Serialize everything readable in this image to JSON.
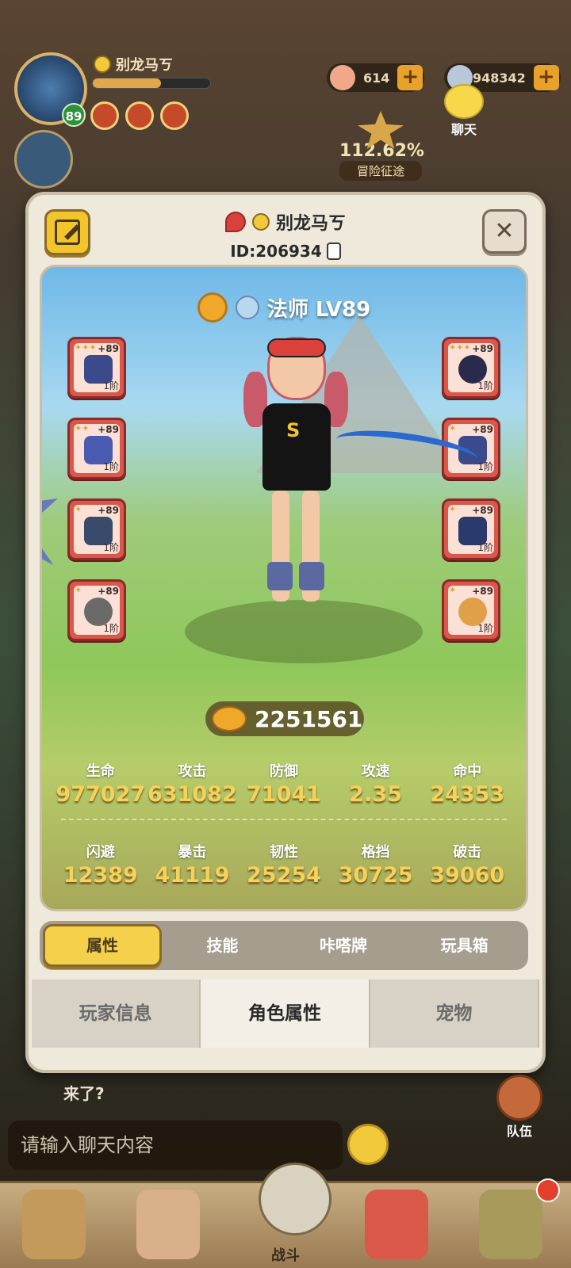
{
  "hud": {
    "player_name": "别龙马ㄎ",
    "level": "89",
    "currency_gems": "614",
    "currency_coins": "948342",
    "chat_label": "聊天",
    "adventure_percent": "112.62%",
    "adventure_label": "冒险征途"
  },
  "profile": {
    "name": "别龙马ㄎ",
    "id": "ID:206934",
    "class_title": "法师 LV89",
    "combat_power": "2251561"
  },
  "equipment_left": [
    {
      "level": "+89",
      "tier": "1阶",
      "stars": "✦✦✦"
    },
    {
      "level": "+89",
      "tier": "1阶",
      "stars": "✦✦"
    },
    {
      "level": "+89",
      "tier": "1阶",
      "stars": "✦"
    },
    {
      "level": "+89",
      "tier": "1阶",
      "stars": "✦"
    }
  ],
  "equipment_right": [
    {
      "level": "+89",
      "tier": "1阶",
      "stars": "✦✦✦"
    },
    {
      "level": "+89",
      "tier": "1阶",
      "stars": "✦"
    },
    {
      "level": "+89",
      "tier": "1阶",
      "stars": "✦"
    },
    {
      "level": "+89",
      "tier": "1阶",
      "stars": "✦"
    }
  ],
  "stats_row1": [
    {
      "label": "生命",
      "value": "977027"
    },
    {
      "label": "攻击",
      "value": "631082"
    },
    {
      "label": "防御",
      "value": "71041"
    },
    {
      "label": "攻速",
      "value": "2.35"
    },
    {
      "label": "命中",
      "value": "24353"
    }
  ],
  "stats_row2": [
    {
      "label": "闪避",
      "value": "12389"
    },
    {
      "label": "暴击",
      "value": "41119"
    },
    {
      "label": "韧性",
      "value": "25254"
    },
    {
      "label": "格挡",
      "value": "30725"
    },
    {
      "label": "破击",
      "value": "39060"
    }
  ],
  "subtabs": [
    "属性",
    "技能",
    "咔嗒牌",
    "玩具箱"
  ],
  "bottom_tabs": [
    "玩家信息",
    "角色属性",
    "宠物"
  ],
  "chat": {
    "last_message": "来了?",
    "input_placeholder": "请输入聊天内容",
    "team_label": "队伍"
  },
  "nav": {
    "fight_label": "战斗"
  }
}
